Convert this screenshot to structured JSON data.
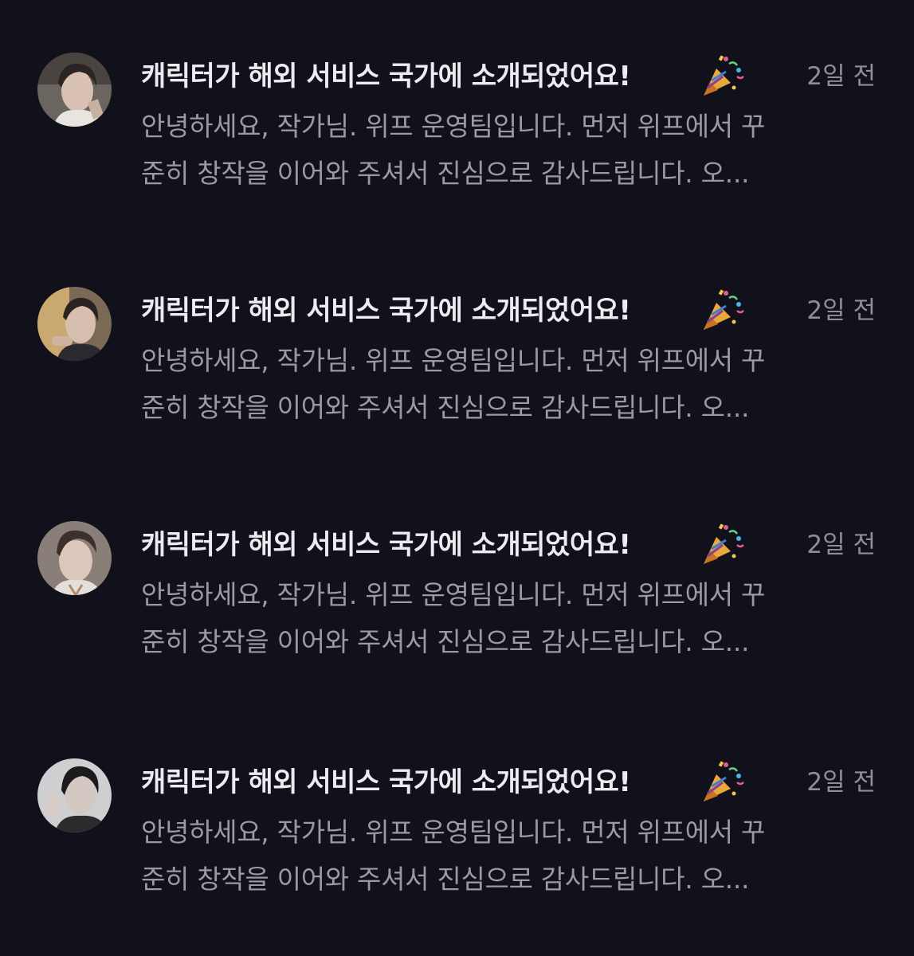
{
  "notifications": [
    {
      "avatar_icon": "character-avatar-icon",
      "title": "캐릭터가 해외 서비스 국가에 소개되었어요!",
      "emoji_icon": "party-popper-icon",
      "time": "2일 전",
      "body_line1": "안녕하세요, 작가님. 위프 운영팀입니다. 먼저 위프에서 꾸",
      "body_line2": "준히 창작을 이어와 주셔서 진심으로 감사드립니다. 오..."
    },
    {
      "avatar_icon": "character-avatar-icon",
      "title": "캐릭터가 해외 서비스 국가에 소개되었어요!",
      "emoji_icon": "party-popper-icon",
      "time": "2일 전",
      "body_line1": "안녕하세요, 작가님. 위프 운영팀입니다. 먼저 위프에서 꾸",
      "body_line2": "준히 창작을 이어와 주셔서 진심으로 감사드립니다. 오..."
    },
    {
      "avatar_icon": "character-avatar-icon",
      "title": "캐릭터가 해외 서비스 국가에 소개되었어요!",
      "emoji_icon": "party-popper-icon",
      "time": "2일 전",
      "body_line1": "안녕하세요, 작가님. 위프 운영팀입니다. 먼저 위프에서 꾸",
      "body_line2": "준히 창작을 이어와 주셔서 진심으로 감사드립니다. 오..."
    },
    {
      "avatar_icon": "character-avatar-icon",
      "title": "캐릭터가 해외 서비스 국가에 소개되었어요!",
      "emoji_icon": "party-popper-icon",
      "time": "2일 전",
      "body_line1": "안녕하세요, 작가님. 위프 운영팀입니다. 먼저 위프에서 꾸",
      "body_line2": "준히 창작을 이어와 주셔서 진심으로 감사드립니다. 오..."
    }
  ],
  "colors": {
    "background": "#11111b",
    "title": "#ebebf0",
    "body": "#9a9aa4",
    "time": "#8e8e98"
  }
}
